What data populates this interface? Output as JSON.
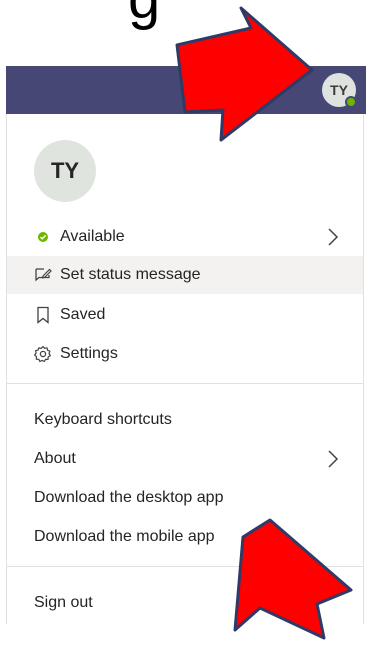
{
  "header": {
    "title": "g",
    "avatar_initials": "TY",
    "presence_color": "#6bb700",
    "bar_color": "#464775"
  },
  "profile": {
    "initials": "TY"
  },
  "menu": {
    "status": {
      "label": "Available",
      "icon": "status-dot-icon"
    },
    "set_status": {
      "label": "Set status message",
      "icon": "edit-message-icon"
    },
    "saved": {
      "label": "Saved",
      "icon": "bookmark-icon"
    },
    "settings": {
      "label": "Settings",
      "icon": "gear-icon"
    },
    "keyboard_shortcuts": {
      "label": "Keyboard shortcuts"
    },
    "about": {
      "label": "About"
    },
    "download_desktop": {
      "label": "Download the desktop app"
    },
    "download_mobile": {
      "label": "Download the mobile app"
    },
    "sign_out": {
      "label": "Sign out"
    }
  },
  "annotations": {
    "arrow_color": "#ff0000",
    "arrow_outline": "#2f3a66"
  }
}
